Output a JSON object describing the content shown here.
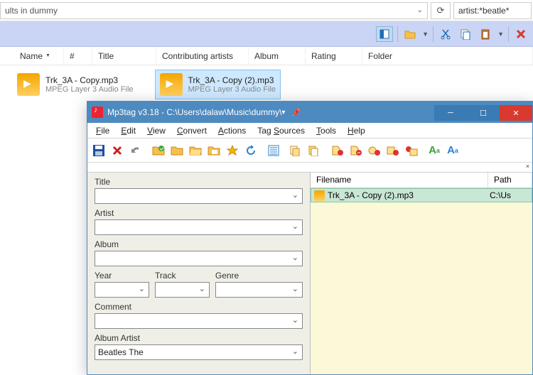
{
  "explorer": {
    "address": "ults in dummy",
    "search": "artist:*beatle*",
    "columns": {
      "name": "Name",
      "num": "#",
      "title": "Title",
      "artists": "Contributing artists",
      "album": "Album",
      "rating": "Rating",
      "folder": "Folder"
    },
    "files": [
      {
        "name": "Trk_3A - Copy.mp3",
        "type": "MPEG Layer 3 Audio File",
        "selected": false
      },
      {
        "name": "Trk_3A - Copy (2).mp3",
        "type": "MPEG Layer 3 Audio File",
        "selected": true
      }
    ]
  },
  "mp3tag": {
    "title": "Mp3tag v3.18  -  C:\\Users\\dalaw\\Music\\dummy\\",
    "menus": {
      "file": "File",
      "edit": "Edit",
      "view": "View",
      "convert": "Convert",
      "actions": "Actions",
      "tagsources": "Tag Sources",
      "tools": "Tools",
      "help": "Help"
    },
    "panel": {
      "title_label": "Title",
      "title": "",
      "artist_label": "Artist",
      "artist": "",
      "album_label": "Album",
      "album": "",
      "year_label": "Year",
      "year": "",
      "track_label": "Track",
      "track": "",
      "genre_label": "Genre",
      "genre": "",
      "comment_label": "Comment",
      "comment": "",
      "albumartist_label": "Album Artist",
      "albumartist": "Beatles The"
    },
    "list": {
      "col_filename": "Filename",
      "col_path": "Path",
      "row_filename": "Trk_3A - Copy (2).mp3",
      "row_path": "C:\\Us"
    }
  }
}
